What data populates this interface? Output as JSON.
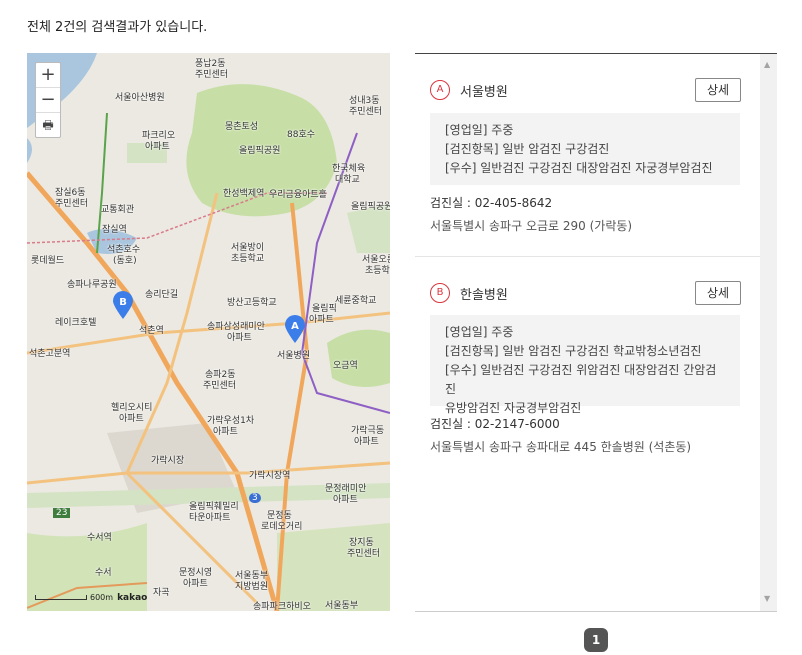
{
  "summary": "전체 2건의 검색결과가 있습니다.",
  "map": {
    "zoom_in": "+",
    "zoom_out": "−",
    "print": "🖶",
    "scale_label": "600m",
    "brand": "kakao",
    "labels": [
      {
        "id": "l1",
        "text": "풍납2동"
      },
      {
        "id": "l2",
        "text": "주민센터"
      },
      {
        "id": "l3",
        "text": "서울아산병원"
      },
      {
        "id": "l4",
        "text": "성내3동"
      },
      {
        "id": "l5",
        "text": "주민센터"
      },
      {
        "id": "l6",
        "text": "몽촌토성"
      },
      {
        "id": "l7",
        "text": "88호수"
      },
      {
        "id": "l8",
        "text": "파크리오"
      },
      {
        "id": "l9",
        "text": "아파트"
      },
      {
        "id": "l10",
        "text": "올림픽공원"
      },
      {
        "id": "l11",
        "text": "한국체육"
      },
      {
        "id": "l12",
        "text": "대학교"
      },
      {
        "id": "l13",
        "text": "잠실6동"
      },
      {
        "id": "l14",
        "text": "주민센터"
      },
      {
        "id": "l15",
        "text": "한성백제역"
      },
      {
        "id": "l16",
        "text": "우리금융아트홀"
      },
      {
        "id": "l17",
        "text": "올림픽공원역"
      },
      {
        "id": "l18",
        "text": "교통회관"
      },
      {
        "id": "l19",
        "text": "잠실역"
      },
      {
        "id": "l20",
        "text": "석촌호수"
      },
      {
        "id": "l21",
        "text": "(동호)"
      },
      {
        "id": "l22",
        "text": "서울방이"
      },
      {
        "id": "l23",
        "text": "초등학교"
      },
      {
        "id": "l24",
        "text": "서울오륜"
      },
      {
        "id": "l25",
        "text": "초등학교"
      },
      {
        "id": "l26",
        "text": "롯데월드"
      },
      {
        "id": "l27",
        "text": "송파나루공원"
      },
      {
        "id": "l28",
        "text": "송리단길"
      },
      {
        "id": "l29",
        "text": "방산고등학교"
      },
      {
        "id": "l30",
        "text": "세륜중학교"
      },
      {
        "id": "l31",
        "text": "레이크호텔"
      },
      {
        "id": "l32",
        "text": "석촌역"
      },
      {
        "id": "l33",
        "text": "송파삼성래미안"
      },
      {
        "id": "l34",
        "text": "아파트"
      },
      {
        "id": "l35",
        "text": "올림픽"
      },
      {
        "id": "l36",
        "text": "아파트"
      },
      {
        "id": "l37",
        "text": "서울병원"
      },
      {
        "id": "l38",
        "text": "오금역"
      },
      {
        "id": "l39",
        "text": "석촌고분역"
      },
      {
        "id": "l40",
        "text": "송파2동"
      },
      {
        "id": "l41",
        "text": "주민센터"
      },
      {
        "id": "l42",
        "text": "헬리오시티"
      },
      {
        "id": "l43",
        "text": "아파트"
      },
      {
        "id": "l44",
        "text": "가락우성1차"
      },
      {
        "id": "l45",
        "text": "아파트"
      },
      {
        "id": "l46",
        "text": "가락극동"
      },
      {
        "id": "l47",
        "text": "아파트"
      },
      {
        "id": "l48",
        "text": "가락시장"
      },
      {
        "id": "l49",
        "text": "가락시장역"
      },
      {
        "id": "l50",
        "text": "문정래미안"
      },
      {
        "id": "l51",
        "text": "아파트"
      },
      {
        "id": "l52",
        "text": "올림픽훼밀리"
      },
      {
        "id": "l53",
        "text": "타운아파트"
      },
      {
        "id": "l54",
        "text": "문정동"
      },
      {
        "id": "l55",
        "text": "로데오거리"
      },
      {
        "id": "l56",
        "text": "수서역"
      },
      {
        "id": "l57",
        "text": "장지동"
      },
      {
        "id": "l58",
        "text": "주민센터"
      },
      {
        "id": "l59",
        "text": "문정시영"
      },
      {
        "id": "l60",
        "text": "아파트"
      },
      {
        "id": "l61",
        "text": "서울동부"
      },
      {
        "id": "l62",
        "text": "지방법원"
      },
      {
        "id": "l63",
        "text": "송파파크하비오"
      },
      {
        "id": "l64",
        "text": "서울동부"
      },
      {
        "id": "l65",
        "text": "수서"
      },
      {
        "id": "l66",
        "text": "자곡"
      },
      {
        "id": "l67",
        "text": "23"
      },
      {
        "id": "l68",
        "text": "3"
      }
    ],
    "pins": [
      {
        "letter": "A",
        "color": "#3b7de9"
      },
      {
        "letter": "B",
        "color": "#3b7de9"
      }
    ]
  },
  "results": [
    {
      "marker": "A",
      "name": "서울병원",
      "detail_label": "상세",
      "info": [
        "[영업일] 주중",
        "[검진항목] 일반 암검진 구강검진",
        "[우수] 일반검진 구강검진 대장암검진 자궁경부암검진"
      ],
      "phone": "검진실 : 02-405-8642",
      "address": "서울특별시 송파구 오금로 290 (가락동)"
    },
    {
      "marker": "B",
      "name": "한솔병원",
      "detail_label": "상세",
      "info": [
        "[영업일] 주중",
        "[검진항목] 일반 암검진 구강검진 학교밖청소년검진",
        "[우수] 일반검진 구강검진 위암검진 대장암검진 간암검진",
        "유방암검진 자궁경부암검진"
      ],
      "phone": "검진실 : 02-2147-6000",
      "address": "서울특별시 송파구 송파대로 445 한솔병원 (석촌동)"
    }
  ],
  "pagination": {
    "current": "1"
  },
  "colors": {
    "marker_red": "#d9363e",
    "pin_blue": "#3b7de9",
    "park_green": "#c7dfa6",
    "water": "#a9c6de",
    "road_orange": "#f0a75b"
  }
}
